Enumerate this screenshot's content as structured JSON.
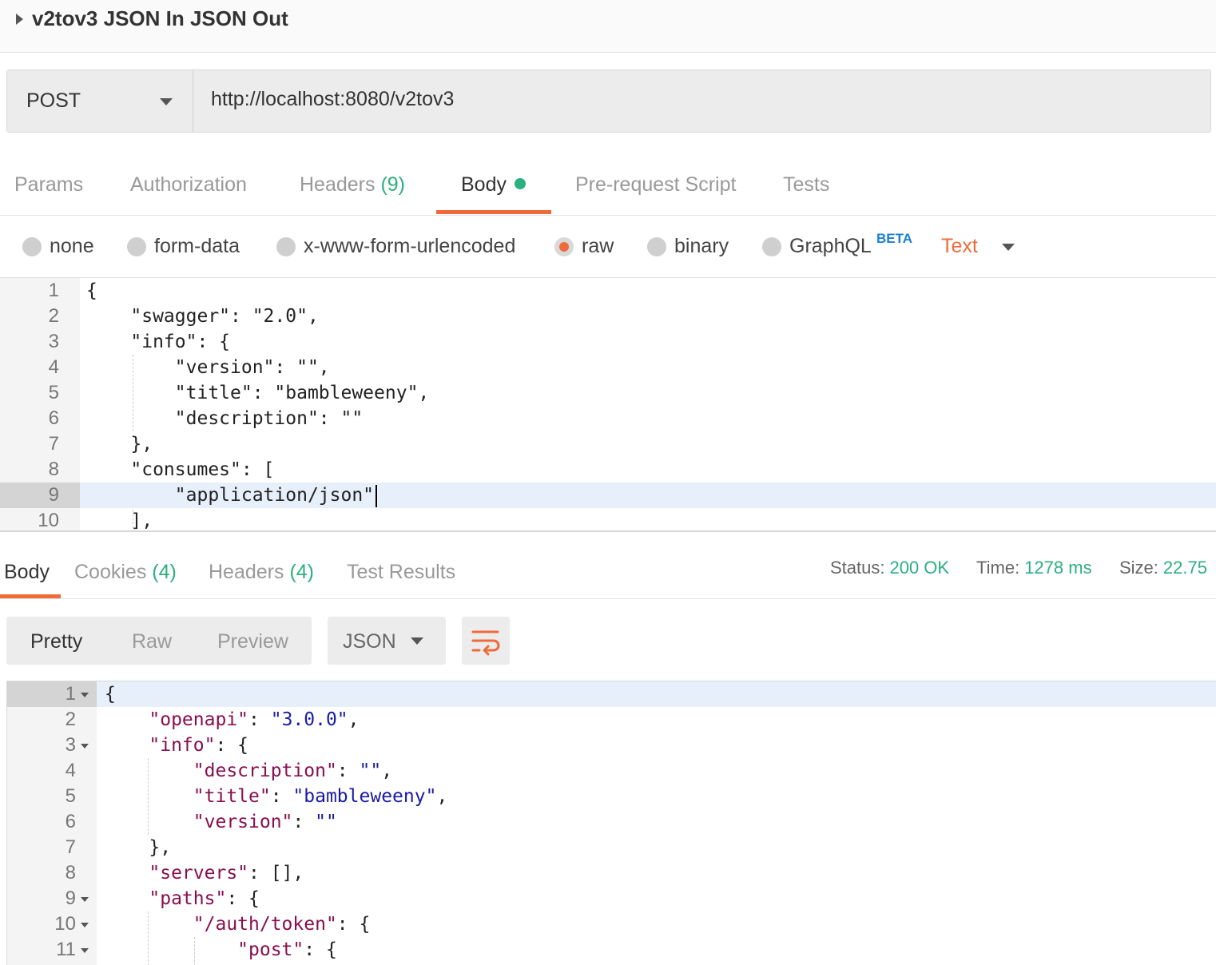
{
  "request": {
    "name": "v2tov3 JSON In JSON Out",
    "method": "POST",
    "url": "http://localhost:8080/v2tov3"
  },
  "request_tabs": {
    "params": "Params",
    "authorization": "Authorization",
    "headers": "Headers",
    "headers_count": "(9)",
    "body": "Body",
    "prerequest": "Pre-request Script",
    "tests": "Tests"
  },
  "body_types": {
    "none": "none",
    "form_data": "form-data",
    "urlencoded": "x-www-form-urlencoded",
    "raw": "raw",
    "binary": "binary",
    "graphql": "GraphQL",
    "beta": "BETA",
    "content_type": "Text",
    "selected": "raw"
  },
  "request_body": {
    "lines": [
      {
        "num": "1",
        "text": "{"
      },
      {
        "num": "2",
        "text": "    \"swagger\": \"2.0\","
      },
      {
        "num": "3",
        "text": "    \"info\": {"
      },
      {
        "num": "4",
        "text": "        \"version\": \"\","
      },
      {
        "num": "5",
        "text": "        \"title\": \"bambleweeny\","
      },
      {
        "num": "6",
        "text": "        \"description\": \"\""
      },
      {
        "num": "7",
        "text": "    },"
      },
      {
        "num": "8",
        "text": "    \"consumes\": ["
      },
      {
        "num": "9",
        "text": "        \"application/json\""
      },
      {
        "num": "10",
        "text": "    ],"
      }
    ],
    "active_line": 9
  },
  "response_tabs": {
    "body": "Body",
    "cookies": "Cookies",
    "cookies_count": "(4)",
    "headers": "Headers",
    "headers_count": "(4)",
    "test_results": "Test Results"
  },
  "response_status": {
    "status_label": "Status:",
    "status_value": "200 OK",
    "time_label": "Time:",
    "time_value": "1278 ms",
    "size_label": "Size:",
    "size_value": "22.75"
  },
  "response_view": {
    "pretty": "Pretty",
    "raw": "Raw",
    "preview": "Preview",
    "format": "JSON",
    "wrap_icon": "wrap-lines-icon"
  },
  "response_body": {
    "lines": [
      {
        "num": "1",
        "fold": true
      },
      {
        "num": "2",
        "fold": false
      },
      {
        "num": "3",
        "fold": true
      },
      {
        "num": "4",
        "fold": false
      },
      {
        "num": "5",
        "fold": false
      },
      {
        "num": "6",
        "fold": false
      },
      {
        "num": "7",
        "fold": false
      },
      {
        "num": "8",
        "fold": false
      },
      {
        "num": "9",
        "fold": true
      },
      {
        "num": "10",
        "fold": true
      },
      {
        "num": "11",
        "fold": true
      }
    ],
    "tokens": {
      "l1": "{",
      "openapi_key": "\"openapi\"",
      "openapi_val": "\"3.0.0\"",
      "info_key": "\"info\"",
      "desc_key": "\"description\"",
      "desc_val": "\"\"",
      "title_key": "\"title\"",
      "title_val": "\"bambleweeny\"",
      "version_key": "\"version\"",
      "version_val": "\"\"",
      "close_info": "},",
      "servers_key": "\"servers\"",
      "servers_val": "[]",
      "paths_key": "\"paths\"",
      "auth_key": "\"/auth/token\"",
      "post_key": "\"post\""
    },
    "active_line": 1
  },
  "colors": {
    "accent": "#ef6b3a",
    "success": "#2bb07f",
    "beta": "#1a7fd6",
    "json_key": "#880e4f",
    "json_string": "#1a1aa6"
  }
}
